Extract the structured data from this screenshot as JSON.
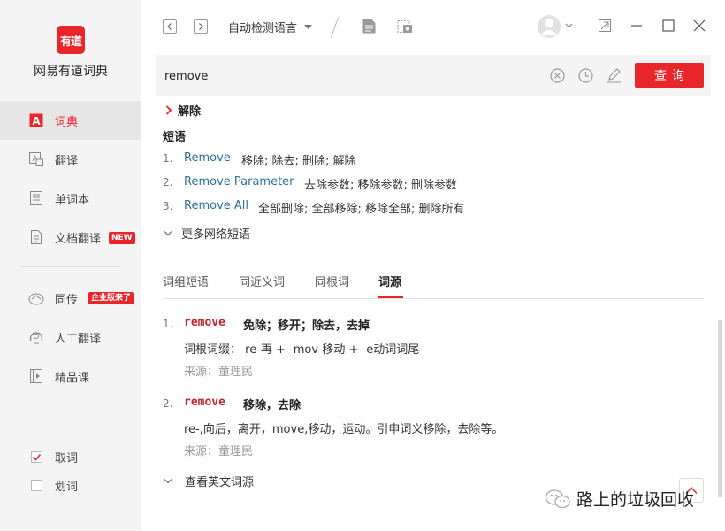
{
  "sidebar": {
    "logo_text": "有道",
    "app_name": "网易有道词典",
    "nav": [
      {
        "label": "词典",
        "icon": "dictionary-icon",
        "active": true
      },
      {
        "label": "翻译",
        "icon": "translate-icon"
      },
      {
        "label": "单词本",
        "icon": "wordbook-icon"
      },
      {
        "label": "文档翻译",
        "icon": "document-translate-icon",
        "badge": "NEW"
      },
      {
        "label": "同传",
        "icon": "simultaneous-icon",
        "badge": "企业版来了"
      },
      {
        "label": "人工翻译",
        "icon": "human-translate-icon"
      },
      {
        "label": "精品课",
        "icon": "course-icon"
      }
    ],
    "checks": [
      {
        "label": "取词",
        "checked": true
      },
      {
        "label": "划词",
        "checked": false
      }
    ]
  },
  "topbar": {
    "language": "自动检测语言"
  },
  "search": {
    "value": "remove",
    "button_label": "查询"
  },
  "result": {
    "meaning_label": "解除",
    "phrases_title": "短语",
    "phrases": [
      {
        "num": "1.",
        "phrase": "Remove",
        "meaning": "移除;  除去;  删除;  解除"
      },
      {
        "num": "2.",
        "phrase": "Remove Parameter",
        "meaning": "去除参数;  移除参数;  删除参数"
      },
      {
        "num": "3.",
        "phrase": "Remove All",
        "meaning": "全部删除;  全部移除;  移除全部;  删除所有"
      }
    ],
    "more_phrases": "更多网络短语"
  },
  "tabs": [
    "词组短语",
    "同近义词",
    "同根词",
    "词源"
  ],
  "active_tab": 3,
  "etymology": [
    {
      "num": "1.",
      "word": "remove",
      "gloss": "免除；移开；除去，去掉",
      "line2": "词根词缀： re-再 + -mov-移动 + -e动词词尾",
      "source": "来源：童理民"
    },
    {
      "num": "2.",
      "word": "remove",
      "gloss": "移除，去除",
      "line2": "re-,向后，离开，move,移动，运动。引申词义移除，去除等。",
      "source": "来源：童理民"
    }
  ],
  "more_etymology": "查看英文词源",
  "watermark": "路上的垃圾回收",
  "colors": {
    "accent": "#e8262a",
    "link": "#2f6f9f"
  }
}
